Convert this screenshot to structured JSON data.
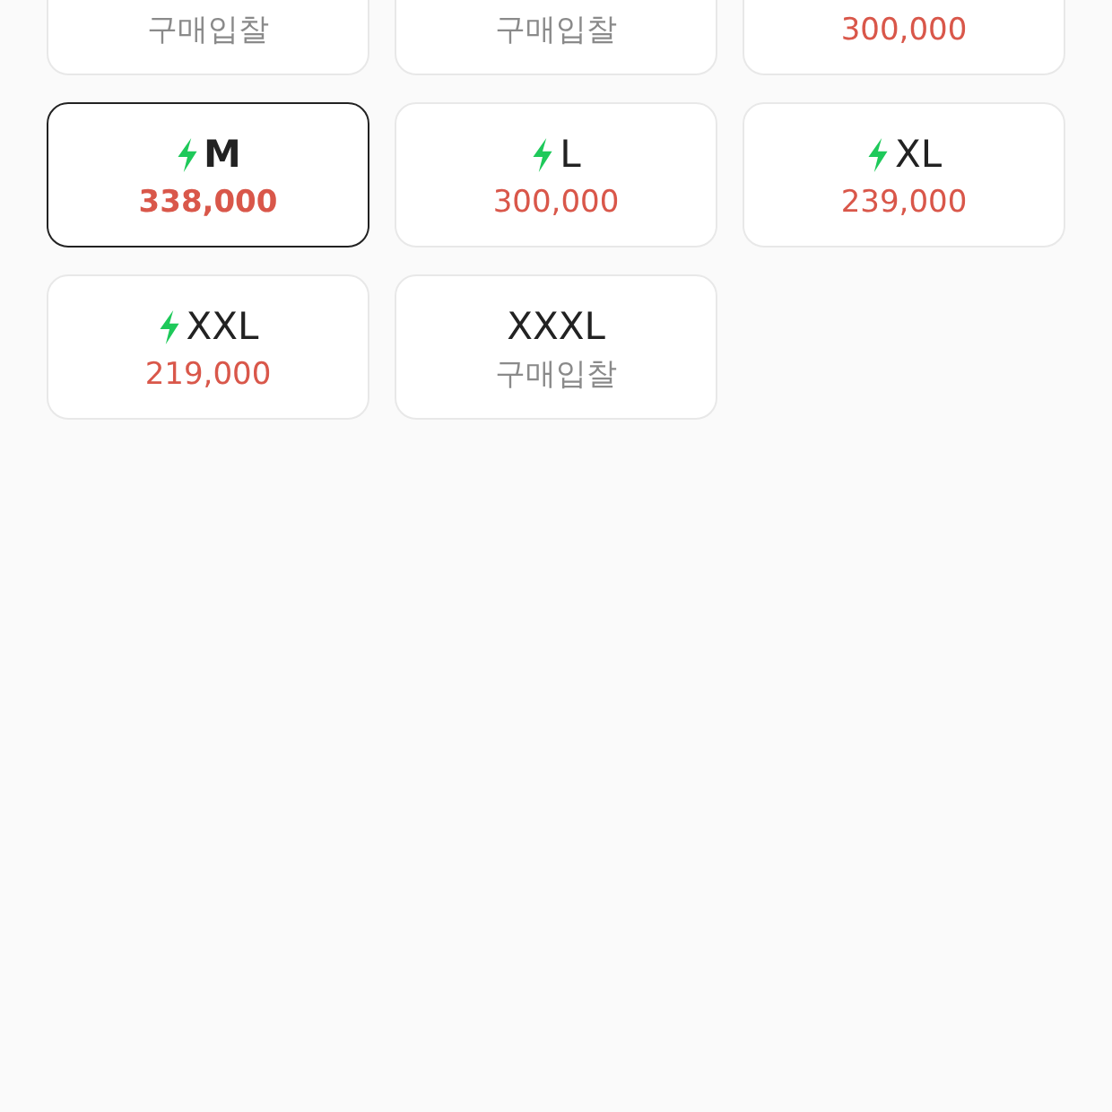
{
  "sizes": [
    {
      "price": "구매입찰",
      "kind": "bid",
      "selected": false
    },
    {
      "price": "구매입찰",
      "kind": "bid",
      "selected": false
    },
    {
      "price": "300,000",
      "kind": "price",
      "selected": false
    },
    {
      "size": "M",
      "price": "338,000",
      "kind": "price",
      "fast": true,
      "selected": true
    },
    {
      "size": "L",
      "price": "300,000",
      "kind": "price",
      "fast": true,
      "selected": false
    },
    {
      "size": "XL",
      "price": "239,000",
      "kind": "price",
      "fast": true,
      "selected": false
    },
    {
      "size": "XXL",
      "price": "219,000",
      "kind": "price",
      "fast": true,
      "selected": false
    },
    {
      "size": "XXXL",
      "price": "구매입찰",
      "kind": "bid",
      "fast": false,
      "selected": false
    }
  ]
}
